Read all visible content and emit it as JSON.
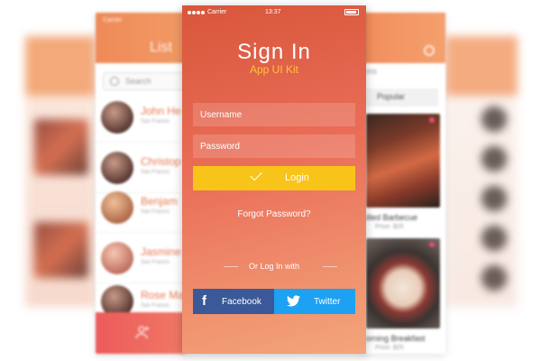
{
  "statusbar": {
    "carrier": "Carrier",
    "time": "13:37"
  },
  "login": {
    "title": "Sign  In",
    "subtitle": "App UI Kit",
    "username_placeholder": "Username",
    "password_placeholder": "Password",
    "login_label": "Login",
    "forgot_label": "Forgot Password?",
    "or_label": "Or Log In with",
    "facebook_label": "Facebook",
    "twitter_label": "Twitter"
  },
  "colors": {
    "accent_yellow": "#f9c41a",
    "facebook_blue": "#3b5998",
    "twitter_blue": "#1da1f2",
    "gradient_top": "#d8563b",
    "gradient_bottom": "#f3a57a"
  },
  "left_phone": {
    "status": "Carrier",
    "title": "List",
    "search_placeholder": "Search",
    "contacts": [
      {
        "name": "John He",
        "sub": "San Francis"
      },
      {
        "name": "Christop",
        "sub": "San Francis"
      },
      {
        "name": "Benjam",
        "sub": "San Francis"
      },
      {
        "name": "Jasmine",
        "sub": "San Francis"
      },
      {
        "name": "Rose Ma",
        "sub": "San Francis"
      }
    ],
    "icons": {
      "footer": "add-user-icon",
      "search": "search-icon"
    }
  },
  "right_phone": {
    "header_text": "ms",
    "tab": "Popular",
    "items": [
      {
        "caption": "illed Barbecue",
        "price": "Price: $25"
      },
      {
        "caption": "orning Breakfast",
        "price": "Price: $25"
      }
    ]
  }
}
